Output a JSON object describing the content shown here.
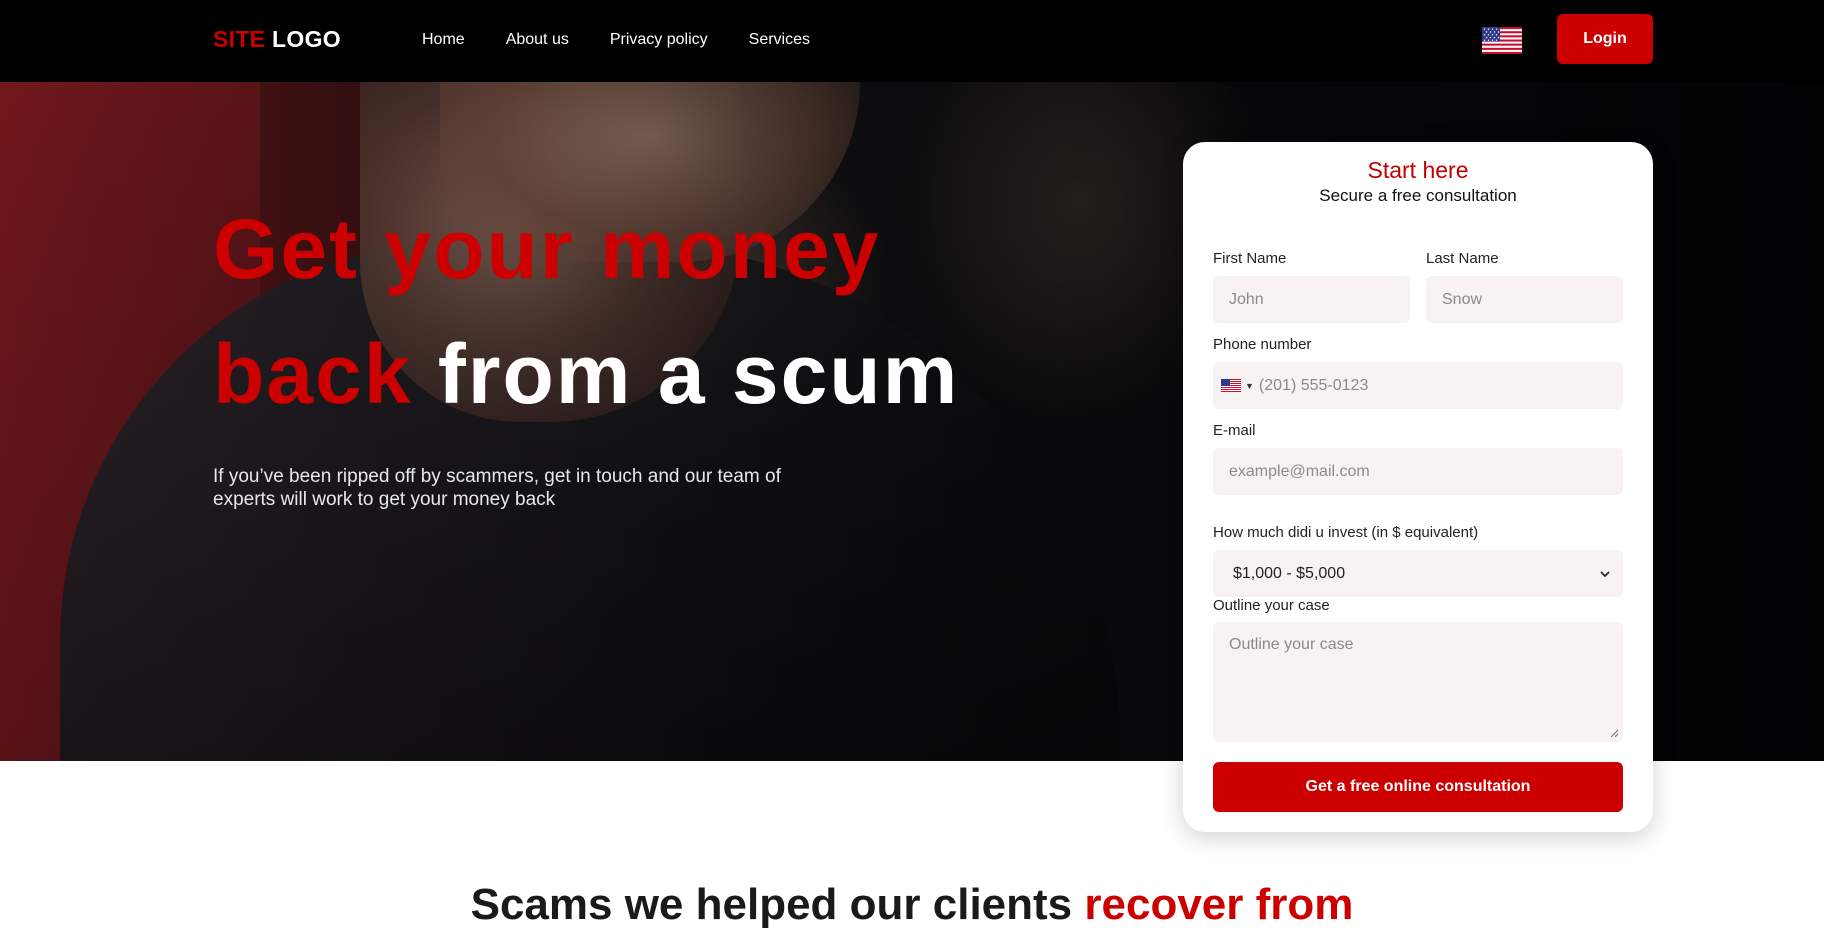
{
  "header": {
    "logo_red": "SITE",
    "logo_white": "LOGO",
    "nav": [
      "Home",
      "About us",
      "Privacy policy",
      "Services"
    ],
    "language_flag_icon": "us-flag-icon",
    "login_label": "Login"
  },
  "hero": {
    "headline_red_1": "Get your money",
    "headline_red_2": "back",
    "headline_white": "from a scum",
    "subtext": "If you’ve been ripped off by scammers, get in touch and our team of experts will work to get your money back"
  },
  "form": {
    "title": "Start here",
    "subtitle": "Secure a free consultation",
    "first_name_label": "First Name",
    "first_name_placeholder": "John",
    "last_name_label": "Last Name",
    "last_name_placeholder": "Snow",
    "phone_label": "Phone number",
    "phone_placeholder": "(201) 555-0123",
    "email_label": "E-mail",
    "email_placeholder": "example@mail.com",
    "invest_label": "How much didi u invest (in $ equivalent)",
    "invest_value": "$1,000 - $5,000",
    "case_label": "Outline your case",
    "case_placeholder": "Outline your case",
    "submit_label": "Get a free online consultation"
  },
  "section": {
    "title_dark": "Scams we helped our clients",
    "title_red": "recover from"
  },
  "colors": {
    "accent": "#cc0000",
    "header_bg": "#000000",
    "field_bg": "#f8f2f2"
  }
}
